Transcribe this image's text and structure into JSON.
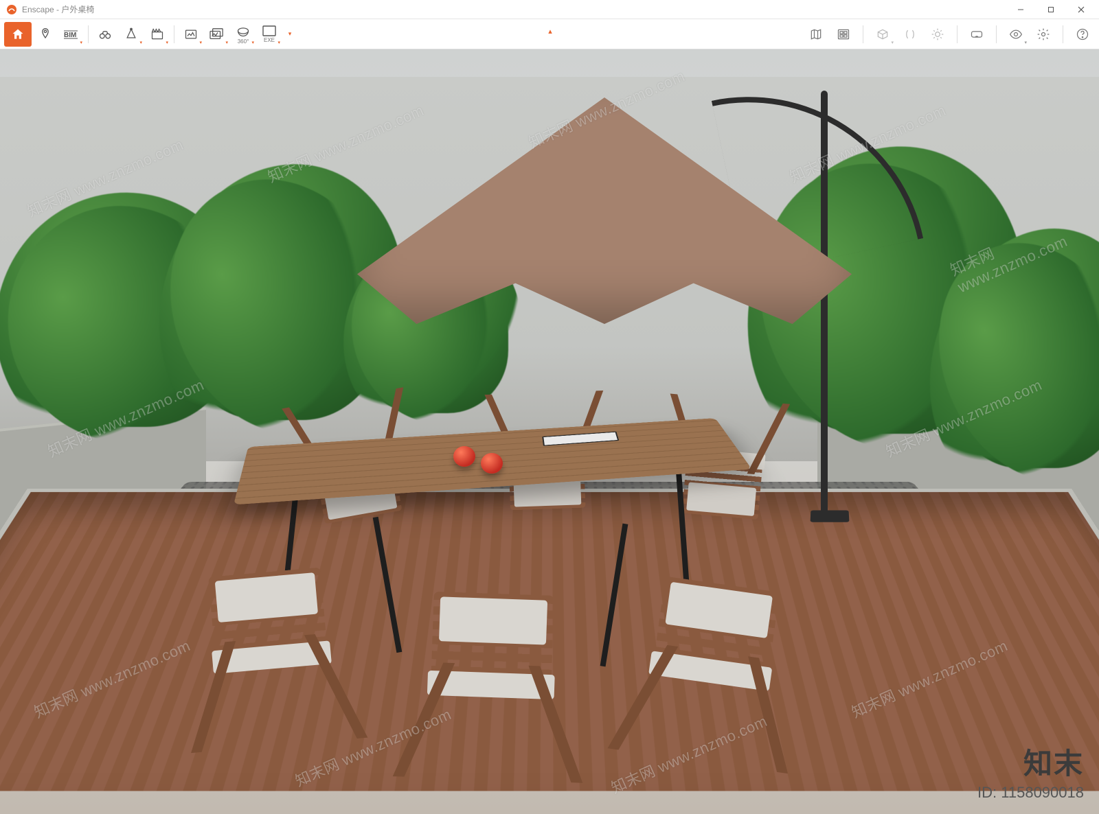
{
  "window": {
    "app_name": "Enscape",
    "document_title": "户外桌椅",
    "title_combined": "Enscape - 户外桌椅"
  },
  "toolbar": {
    "home": "Home",
    "pin": "Pin",
    "bim": "BIM",
    "binoculars": "Views",
    "view_cone": "Perspective",
    "clapper": "Video",
    "screenshot": "Screenshot",
    "batch": "Batch",
    "pano": "360°",
    "exe": "EXE",
    "map": "Map",
    "assets": "Assets",
    "box": "BBox",
    "mirror": "Mirror",
    "sun": "Sun",
    "vr": "VR",
    "eye": "View",
    "settings": "Settings",
    "help": "Help"
  },
  "watermark": {
    "repeat": "知末网 www.znzmo.com",
    "brand": "知末",
    "id_label": "ID:",
    "id_value": "1158090018"
  },
  "scene": {
    "description": "Outdoor patio render: wooden slatted dining table with six wooden armchairs and light cushions on a timber deck, cantilever tan umbrella, tropical planting in concrete planters behind, books and apples on table."
  }
}
